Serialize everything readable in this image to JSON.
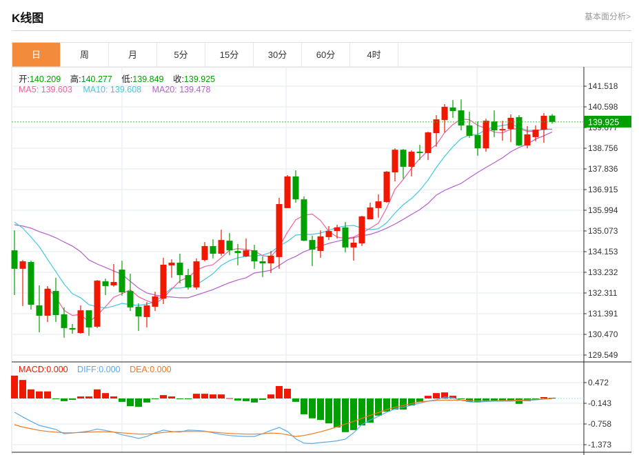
{
  "header": {
    "title": "K线图",
    "link": "基本面分析>"
  },
  "tabs": [
    {
      "label": "日",
      "active": true
    },
    {
      "label": "周"
    },
    {
      "label": "月"
    },
    {
      "label": "5分"
    },
    {
      "label": "15分"
    },
    {
      "label": "30分"
    },
    {
      "label": "60分"
    },
    {
      "label": "4时"
    }
  ],
  "ohlc_legend": {
    "open_label": "开:",
    "open": "140.209",
    "high_label": "高:",
    "high": "140.277",
    "low_label": "低:",
    "low": "139.849",
    "close_label": "收:",
    "close": "139.925"
  },
  "ma_legend": {
    "ma5": "MA5: 139.603",
    "ma10": "MA10: 139.608",
    "ma20": "MA20: 139.478"
  },
  "macd_legend": {
    "macd": "MACD:0.000",
    "diff": "DIFF:0.000",
    "dea": "DEA:0.000"
  },
  "colors": {
    "up": "#f01800",
    "down": "#00a000",
    "ma5": "#f0609a",
    "ma10": "#40c8e0",
    "ma20": "#b55ecc",
    "diff": "#5aaae8",
    "dea": "#f07820",
    "accent": "#f38b3c"
  },
  "chart_data": [
    {
      "type": "candlestick",
      "y_ticks": [
        "141.518",
        "140.598",
        "139.677",
        "138.756",
        "137.836",
        "136.915",
        "135.994",
        "135.073",
        "134.153",
        "133.232",
        "132.311",
        "131.391",
        "130.470",
        "129.549"
      ],
      "ylim": [
        129.549,
        141.518
      ],
      "last_price": "139.925",
      "grid": true,
      "ohlc": [
        [
          134.21,
          135.1,
          132.22,
          133.39
        ],
        [
          133.39,
          133.78,
          131.73,
          133.72
        ],
        [
          133.69,
          133.75,
          131.57,
          131.79
        ],
        [
          131.76,
          132.65,
          130.56,
          131.3
        ],
        [
          131.3,
          132.62,
          131.02,
          132.5
        ],
        [
          132.4,
          132.99,
          131.02,
          131.33
        ],
        [
          131.36,
          131.67,
          130.32,
          130.75
        ],
        [
          130.75,
          130.93,
          130.5,
          130.68
        ],
        [
          130.53,
          131.76,
          130.5,
          131.54
        ],
        [
          131.54,
          131.54,
          130.41,
          130.78
        ],
        [
          130.81,
          132.89,
          130.75,
          132.86
        ],
        [
          132.83,
          132.95,
          132.22,
          132.62
        ],
        [
          132.65,
          133.6,
          132.59,
          132.8
        ],
        [
          133.35,
          133.75,
          132.19,
          132.34
        ],
        [
          132.4,
          133.17,
          131.51,
          131.67
        ],
        [
          131.7,
          131.85,
          130.62,
          131.27
        ],
        [
          131.24,
          131.91,
          130.78,
          131.76
        ],
        [
          131.7,
          132.37,
          131.51,
          132.16
        ],
        [
          132.06,
          133.88,
          131.82,
          133.57
        ],
        [
          133.54,
          133.81,
          132.99,
          133.66
        ],
        [
          133.66,
          134.06,
          132.74,
          133.11
        ],
        [
          133.11,
          133.39,
          132.46,
          132.56
        ],
        [
          132.56,
          133.85,
          132.46,
          133.72
        ],
        [
          133.78,
          134.58,
          133.72,
          134.4
        ],
        [
          134.4,
          134.7,
          133.85,
          134.06
        ],
        [
          134.06,
          135.13,
          133.97,
          134.67
        ],
        [
          134.64,
          134.98,
          134.0,
          134.21
        ],
        [
          134.18,
          134.49,
          133.54,
          134.09
        ],
        [
          133.94,
          134.74,
          133.91,
          134.21
        ],
        [
          134.21,
          134.46,
          133.39,
          133.72
        ],
        [
          133.72,
          133.94,
          133.02,
          133.63
        ],
        [
          133.63,
          134.18,
          133.2,
          133.97
        ],
        [
          133.91,
          136.55,
          133.39,
          136.27
        ],
        [
          136.09,
          137.56,
          136.09,
          137.5
        ],
        [
          137.5,
          137.77,
          136.33,
          136.48
        ],
        [
          136.48,
          136.61,
          134.62,
          134.64
        ],
        [
          134.67,
          134.86,
          133.51,
          134.24
        ],
        [
          134.18,
          135.1,
          133.88,
          134.83
        ],
        [
          134.8,
          135.29,
          134.67,
          135.07
        ],
        [
          135.07,
          135.35,
          134.74,
          135.23
        ],
        [
          135.23,
          135.47,
          134.12,
          134.34
        ],
        [
          134.34,
          134.8,
          133.75,
          134.55
        ],
        [
          134.52,
          135.75,
          134.4,
          135.72
        ],
        [
          135.59,
          136.33,
          135.59,
          136.12
        ],
        [
          136.09,
          136.7,
          135.66,
          136.39
        ],
        [
          136.36,
          137.74,
          136.33,
          137.71
        ],
        [
          137.68,
          138.75,
          137.28,
          138.69
        ],
        [
          138.69,
          138.72,
          137.4,
          137.93
        ],
        [
          137.93,
          138.66,
          137.5,
          138.6
        ],
        [
          138.6,
          138.91,
          138.23,
          138.54
        ],
        [
          138.54,
          139.49,
          138.23,
          139.46
        ],
        [
          139.43,
          140.23,
          138.82,
          140.04
        ],
        [
          140.01,
          140.72,
          139.46,
          140.6
        ],
        [
          140.57,
          140.9,
          140.11,
          140.41
        ],
        [
          140.44,
          140.93,
          139.55,
          139.77
        ],
        [
          139.77,
          140.38,
          139.22,
          139.31
        ],
        [
          139.34,
          139.95,
          138.42,
          138.75
        ],
        [
          138.75,
          140.07,
          138.6,
          139.98
        ],
        [
          139.95,
          140.44,
          139.25,
          139.55
        ],
        [
          139.55,
          139.98,
          139.09,
          139.61
        ],
        [
          139.61,
          140.26,
          139.03,
          140.11
        ],
        [
          140.14,
          140.23,
          138.85,
          138.88
        ],
        [
          138.88,
          139.74,
          138.75,
          139.37
        ],
        [
          139.25,
          139.77,
          139.06,
          139.58
        ],
        [
          139.58,
          140.32,
          139.0,
          140.2
        ],
        [
          140.209,
          140.277,
          139.849,
          139.925
        ]
      ],
      "ma10": [
        135.47,
        135.2,
        134.8,
        134.37,
        133.81,
        133.26,
        132.71,
        132.28,
        132.1,
        131.79,
        131.7,
        131.64,
        131.73,
        131.85,
        131.79,
        131.76,
        131.82,
        131.91,
        132.22,
        132.53,
        132.53,
        132.59,
        132.68,
        132.92,
        133.17,
        133.54,
        133.75,
        133.88,
        133.94,
        133.97,
        134.0,
        134.12,
        134.4,
        134.61,
        134.89,
        134.92,
        134.92,
        134.98,
        135.1,
        135.23,
        135.29,
        135.32,
        135.2,
        135.13,
        135.17,
        135.44,
        135.87,
        136.24,
        136.52,
        136.88,
        137.34,
        137.9,
        138.39,
        138.82,
        139.19,
        139.34,
        139.37,
        139.58,
        139.71,
        139.77,
        139.83,
        139.68,
        139.55,
        139.55,
        139.58,
        139.61
      ],
      "ma20": [
        135.35,
        135.29,
        135.2,
        135.04,
        134.92,
        134.77,
        134.58,
        134.4,
        134.15,
        133.78,
        133.6,
        133.45,
        133.29,
        133.14,
        132.83,
        132.53,
        132.31,
        132.22,
        132.16,
        132.13,
        132.1,
        132.1,
        132.22,
        132.34,
        132.46,
        132.62,
        132.77,
        132.89,
        132.99,
        133.2,
        133.26,
        133.32,
        133.54,
        133.78,
        133.94,
        134.15,
        134.28,
        134.4,
        134.52,
        134.61,
        134.7,
        134.77,
        134.86,
        134.92,
        135.04,
        135.2,
        135.38,
        135.59,
        135.81,
        136.02,
        136.3,
        136.67,
        136.88,
        137.04,
        137.19,
        137.44,
        137.68,
        137.9,
        138.11,
        138.33,
        138.6,
        138.79,
        138.94,
        139.16,
        139.31,
        139.48
      ]
    },
    {
      "type": "bar+line",
      "y_ticks": [
        "0.472",
        "-0.143",
        "-0.758",
        "-1.373"
      ],
      "macd": [
        0.68,
        0.55,
        0.27,
        0.21,
        0.21,
        -0.01,
        -0.08,
        -0.04,
        0.06,
        0.06,
        0.27,
        0.16,
        0.06,
        -0.1,
        -0.23,
        -0.25,
        -0.12,
        -0.02,
        0.1,
        0.06,
        -0.02,
        -0.02,
        0.14,
        0.14,
        0.12,
        0.12,
        0.01,
        -0.06,
        -0.08,
        -0.12,
        -0.04,
        0.12,
        0.37,
        0.29,
        -0.1,
        -0.47,
        -0.59,
        -0.64,
        -0.74,
        -0.86,
        -1.0,
        -0.94,
        -0.8,
        -0.72,
        -0.51,
        -0.39,
        -0.33,
        -0.33,
        -0.21,
        -0.1,
        0.08,
        0.16,
        0.18,
        0.08,
        -0.02,
        -0.1,
        -0.1,
        -0.08,
        -0.06,
        -0.08,
        -0.08,
        -0.16,
        -0.08,
        -0.02,
        0.04,
        0.02
      ],
      "diff": [
        -0.41,
        -0.55,
        -0.68,
        -0.8,
        -0.86,
        -0.92,
        -1.05,
        -1.03,
        -1.0,
        -0.97,
        -0.91,
        -0.95,
        -1.0,
        -1.08,
        -1.13,
        -1.19,
        -1.13,
        -1.02,
        -0.94,
        -0.98,
        -1.0,
        -0.94,
        -0.95,
        -0.97,
        -1.02,
        -1.07,
        -1.1,
        -1.12,
        -1.13,
        -1.13,
        -1.05,
        -0.95,
        -0.86,
        -0.98,
        -1.2,
        -1.33,
        -1.34,
        -1.31,
        -1.29,
        -1.26,
        -1.21,
        -1.02,
        -0.78,
        -0.64,
        -0.53,
        -0.41,
        -0.31,
        -0.26,
        -0.2,
        -0.14,
        -0.08,
        -0.04,
        0.04,
        0.02,
        -0.05,
        -0.1,
        -0.11,
        -0.09,
        -0.08,
        -0.08,
        -0.08,
        -0.07,
        -0.06,
        -0.04,
        -0.02,
        0.0
      ],
      "dea": [
        -0.78,
        -0.85,
        -0.9,
        -0.95,
        -0.98,
        -1.0,
        -1.02,
        -1.02,
        -1.01,
        -1.0,
        -0.99,
        -0.99,
        -1.0,
        -1.02,
        -1.04,
        -1.06,
        -1.06,
        -1.04,
        -1.01,
        -0.99,
        -0.98,
        -0.98,
        -0.98,
        -0.98,
        -1.0,
        -1.02,
        -1.04,
        -1.05,
        -1.06,
        -1.06,
        -1.05,
        -1.03,
        -1.04,
        -1.08,
        -1.13,
        -1.1,
        -1.05,
        -0.99,
        -0.92,
        -0.84,
        -0.76,
        -0.68,
        -0.59,
        -0.5,
        -0.42,
        -0.33,
        -0.26,
        -0.21,
        -0.15,
        -0.1,
        -0.08,
        -0.06,
        -0.05,
        -0.05,
        -0.05,
        -0.06,
        -0.07,
        -0.07,
        -0.07,
        -0.06,
        -0.06,
        -0.05,
        -0.04,
        -0.03,
        -0.02,
        0.0
      ]
    }
  ]
}
